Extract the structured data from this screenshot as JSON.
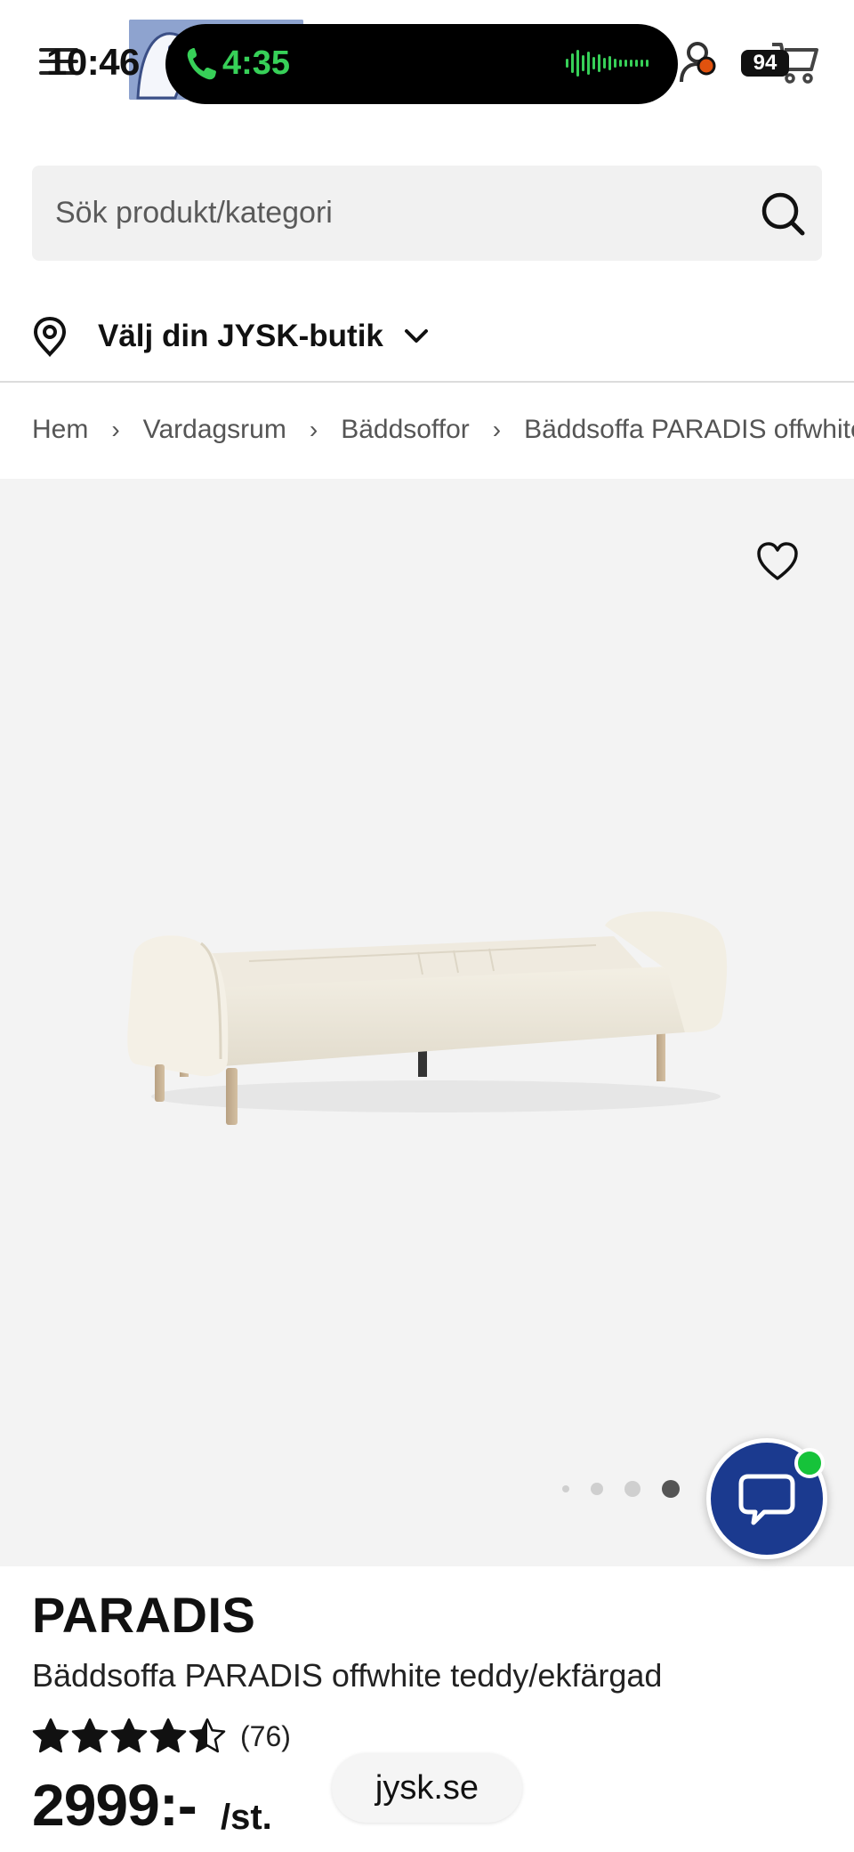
{
  "status_bar": {
    "time": "10:46",
    "call_time": "4:35",
    "battery": "94"
  },
  "search": {
    "placeholder": "Sök produkt/kategori"
  },
  "store_picker": {
    "label": "Välj din JYSK-butik"
  },
  "breadcrumb": {
    "items": [
      "Hem",
      "Vardagsrum",
      "Bäddsoffor",
      "Bäddsoffa PARADIS offwhite teddy/ekfärgad"
    ],
    "separator": "›"
  },
  "gallery": {
    "image_count": 4,
    "active_index": 4
  },
  "product": {
    "brand": "PARADIS",
    "subtitle": "Bäddsoffa PARADIS offwhite teddy/ekfärgad",
    "rating": 4.5,
    "rating_count": "(76)",
    "price": "2999:-",
    "price_unit": "/st."
  },
  "browser": {
    "url": "jysk.se"
  },
  "colors": {
    "call_green": "#37d058",
    "chat_blue": "#1b3a8f",
    "online_green": "#16c33a",
    "gallery_bg": "#f3f3f3"
  }
}
